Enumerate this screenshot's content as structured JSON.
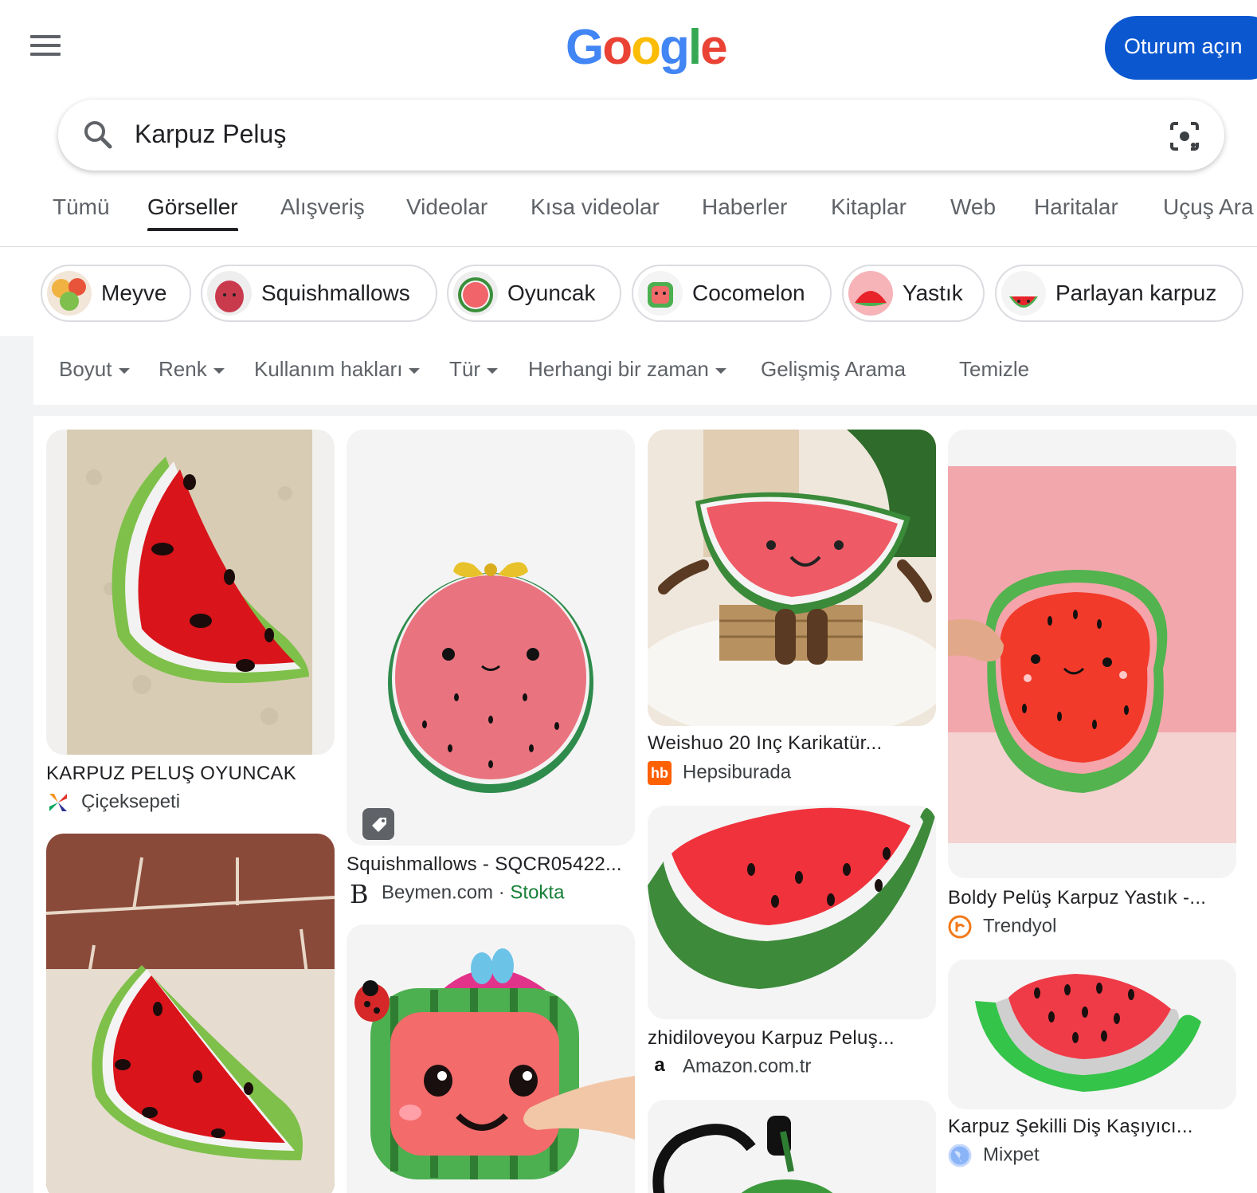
{
  "header": {
    "logo_letters": [
      "G",
      "o",
      "o",
      "g",
      "l",
      "e"
    ],
    "signin_label": "Oturum açın"
  },
  "search": {
    "query": "Karpuz Peluş"
  },
  "tabs": [
    "Tümü",
    "Görseller",
    "Alışveriş",
    "Videolar",
    "Kısa videolar",
    "Haberler",
    "Kitaplar",
    "Web",
    "Haritalar",
    "Uçuş Ara"
  ],
  "active_tab": "Görseller",
  "chips": [
    "Meyve",
    "Squishmallows",
    "Oyuncak",
    "Cocomelon",
    "Yastık",
    "Parlayan karpuz"
  ],
  "filters": {
    "size": "Boyut",
    "color": "Renk",
    "usage_rights": "Kullanım hakları",
    "type": "Tür",
    "time": "Herhangi bir zaman",
    "advanced": "Gelişmiş Arama",
    "clear": "Temizle"
  },
  "results": [
    {
      "title": "KARPUZ PELUŞ OYUNCAK",
      "source": "Çiçeksepeti"
    },
    {
      "title": "Squishmallows - SQCR05422...",
      "source": "Beymen.com",
      "stock": "Stokta",
      "separator": "·"
    },
    {
      "title": "Weishuo 20 Inç Karikatür...",
      "source": "Hepsiburada",
      "favicon_text": "hb"
    },
    {
      "title": "Boldy Pelüş Karpuz Yastık -...",
      "source": "Trendyol"
    },
    {
      "title": "zhidiloveyou Karpuz Peluş...",
      "source": "Amazon.com.tr",
      "favicon_text": "a"
    },
    {
      "title": "Karpuz Şekilli Diş Kaşıyıcı...",
      "source": "Mixpet"
    }
  ],
  "colors": {
    "accent_blue": "#0b57d0",
    "in_stock_green": "#188038",
    "watermelon_red": "#e8232a",
    "rind_green": "#4caf50"
  }
}
